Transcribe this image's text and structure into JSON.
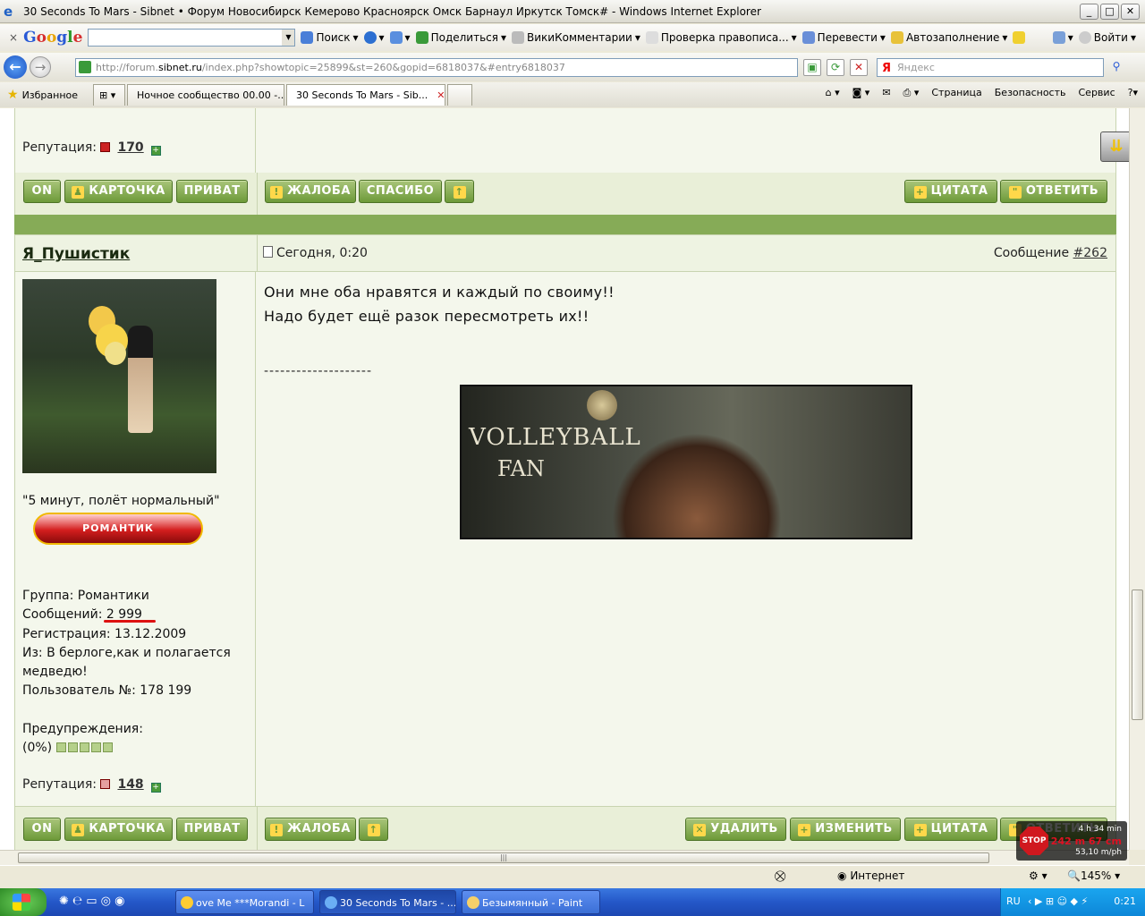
{
  "window": {
    "title": "30 Seconds To Mars - Sibnet • Форум Новосибирск Кемерово Красноярск Омск Барнаул Иркутск Томск# - Windows Internet Explorer"
  },
  "google_bar": {
    "close": "×",
    "logo": [
      "G",
      "o",
      "o",
      "g",
      "l",
      "e"
    ],
    "search_label": "Поиск",
    "share": "Поделиться",
    "wiki": "ВикиКомментарии",
    "spell": "Проверка правописа...",
    "translate": "Перевести",
    "autofill": "Автозаполнение",
    "login": "Войти"
  },
  "nav": {
    "url_prefix": "http://forum.",
    "url_domain": "sibnet.ru",
    "url_rest": "/index.php?showtopic=25899&st=260&gopid=6818037&#entry6818037",
    "search_placeholder": "Яндекс"
  },
  "tabs": {
    "favorites": "Избранное",
    "tab1": "Ночное сообщество 00.00 -...",
    "tab2": "30 Seconds To Mars - Sib...",
    "page": "Страница",
    "security": "Безопасность",
    "service": "Сервис"
  },
  "forum": {
    "prev_rep_label": "Репутация:",
    "prev_rep_value": "170",
    "btn_on": "ON",
    "btn_card": "КАРТОЧКА",
    "btn_private": "ПРИВАТ",
    "btn_complaint": "ЖАЛОБА",
    "btn_thanks": "СПАСИБО",
    "btn_quote": "ЦИТАТА",
    "btn_reply": "ОТВЕТИТЬ",
    "btn_delete": "УДАЛИТЬ",
    "btn_edit": "ИЗМЕНИТЬ",
    "post": {
      "author": "Я_Пушистик",
      "date": "Сегодня, 0:20",
      "number_label": "Сообщение",
      "number": "#262",
      "status": "\"5 минут, полёт нормальный\"",
      "badge": "РОМАНТИК",
      "group": "Группа: Романтики",
      "messages_label": "Сообщений:",
      "messages_value": "2 999",
      "registration": "Регистрация: 13.12.2009",
      "from": "Из: В берлоге,как и полагается",
      "from2": "медведю!",
      "user_no": "Пользователь №: 178 199",
      "warnings": "Предупреждения:",
      "warnings_value": "(0%)",
      "rep_label": "Репутация:",
      "rep_value": "148",
      "text1": "Они мне оба нравятся и каждый по своиму!!",
      "text2": "Надо будет ещё разок пересмотреть их!!",
      "signature_sep": "--------------------",
      "banner_line1": "VOLLEYBALL",
      "banner_line2": "FAN"
    }
  },
  "statusbar": {
    "zone": "Интернет",
    "zoom": "145%"
  },
  "overlay": {
    "time": "4 h 34 min",
    "dist": "242 m 67 cm",
    "speed": "53,10 m/ph",
    "stop": "STOP"
  },
  "taskbar": {
    "t1": "ove Me ***Morandi - L",
    "t2": "30 Seconds To Mars - ...",
    "t3": "Безымянный - Paint",
    "lang": "RU",
    "clock": "0:21"
  },
  "colors": {
    "forum_green": "#86ab57",
    "button_green": "#6d9a39",
    "accent_red": "#d11"
  }
}
